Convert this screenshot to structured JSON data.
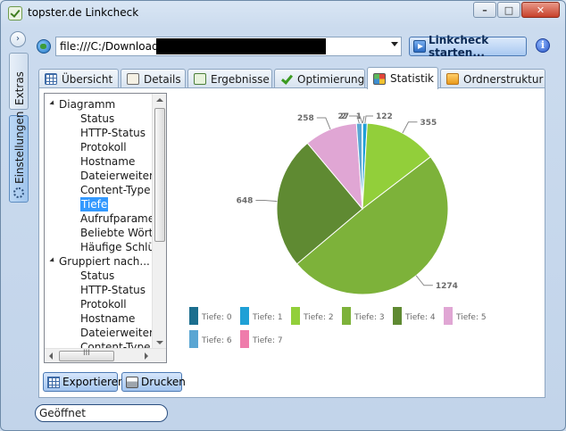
{
  "window": {
    "title": "topster.de Linkcheck"
  },
  "rail": {
    "extras_label": "Extras",
    "settings_label": "Einstellungen"
  },
  "address": {
    "value": "file:///C:/Downloads/"
  },
  "toolbar": {
    "start_label": "Linkcheck starten...",
    "info_label": "i"
  },
  "tabs": [
    {
      "label": "Übersicht",
      "icon": "grid-icon"
    },
    {
      "label": "Details",
      "icon": "details-icon"
    },
    {
      "label": "Ergebnisse",
      "icon": "bubble-icon"
    },
    {
      "label": "Optimierung",
      "icon": "check-icon"
    },
    {
      "label": "Statistik",
      "icon": "statistics-icon",
      "active": true
    },
    {
      "label": "Ordnerstruktur",
      "icon": "folder-icon"
    }
  ],
  "tree": {
    "groups": [
      {
        "label": "Diagramm",
        "items": [
          "Status",
          "HTTP-Status",
          "Protokoll",
          "Hostname",
          "Dateierweiteru",
          "Content-Type",
          "Tiefe",
          "Aufrufparamet",
          "Beliebte Wörte",
          "Häufige Schlüs"
        ]
      },
      {
        "label": "Gruppiert nach...",
        "items": [
          "Status",
          "HTTP-Status",
          "Protokoll",
          "Hostname",
          "Dateierweiteru",
          "Content-Type"
        ]
      }
    ],
    "selected": "Tiefe",
    "hscroll_grip": "III"
  },
  "buttons": {
    "export_label": "Exportieren",
    "print_label": "Drucken"
  },
  "status": {
    "text": "Geöffnet"
  },
  "chart_data": {
    "type": "pie",
    "title": "",
    "categories": [
      "Tiefe: 0",
      "Tiefe: 1",
      "Tiefe: 2",
      "Tiefe: 3",
      "Tiefe: 4",
      "Tiefe: 5",
      "Tiefe: 6",
      "Tiefe: 7"
    ],
    "values": [
      1,
      22,
      355,
      1274,
      648,
      258,
      27,
      2
    ],
    "data_labels": [
      "1",
      "122",
      "355",
      "1274",
      "648",
      "258",
      "27",
      "2"
    ],
    "colors": [
      "#1b6e8e",
      "#1fa0d6",
      "#92cf3a",
      "#7db23a",
      "#5f8a32",
      "#e0a6d4",
      "#5aa6d3",
      "#ef7cab"
    ],
    "legend_position": "bottom"
  }
}
